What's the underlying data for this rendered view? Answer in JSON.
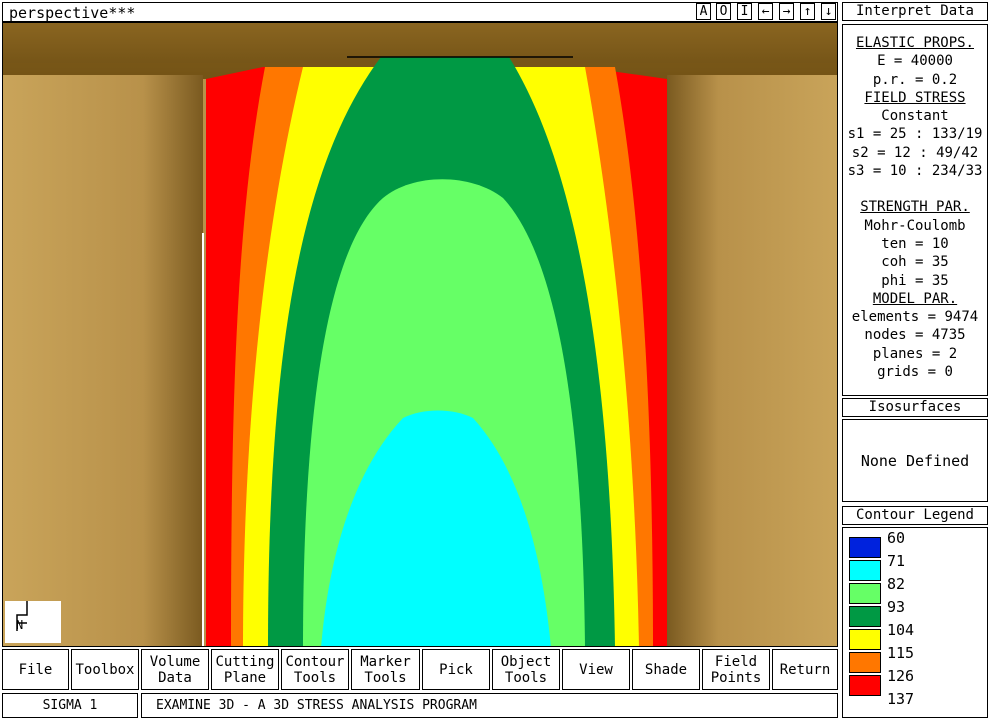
{
  "window": {
    "title": "perspective***",
    "nav_buttons": [
      "A",
      "O",
      "I",
      "←",
      "→",
      "↑",
      "↓"
    ]
  },
  "sidepanel": {
    "interpret_header": "Interpret Data",
    "elastic_header": "ELASTIC PROPS.",
    "e_value": "E = 40000",
    "pr_value": "p.r. = 0.2",
    "field_stress_header": "FIELD STRESS",
    "field_stress_type": "Constant",
    "s1": "s1 = 25 : 133/19",
    "s2": "s2 = 12 : 49/42",
    "s3": "s3 = 10 : 234/33",
    "strength_header": "STRENGTH PAR.",
    "strength_model": "Mohr-Coulomb",
    "ten": "ten = 10",
    "coh": "coh = 35",
    "phi": "phi = 35",
    "model_header": "MODEL PAR.",
    "elements": "elements = 9474",
    "nodes": "nodes = 4735",
    "planes": "planes = 2",
    "grids": "grids = 0",
    "isosurfaces_header": "Isosurfaces",
    "isosurfaces_value": "None Defined",
    "legend_header": "Contour Legend",
    "legend": [
      {
        "value": "60",
        "color": "#0022dd"
      },
      {
        "value": "71",
        "color": "#00ffff"
      },
      {
        "value": "82",
        "color": "#66ff66"
      },
      {
        "value": "93",
        "color": "#009944"
      },
      {
        "value": "104",
        "color": "#ffff00"
      },
      {
        "value": "115",
        "color": "#ff7700"
      },
      {
        "value": "126",
        "color": "#ff0000"
      },
      {
        "value": "137",
        "color": "#ffffff"
      }
    ]
  },
  "toolbar": {
    "file": "File",
    "toolbox": "Toolbox",
    "volume_data": "Volume\nData",
    "cutting_plane": "Cutting\nPlane",
    "contour_tools": "Contour\nTools",
    "marker_tools": "Marker\nTools",
    "pick": "Pick",
    "object_tools": "Object\nTools",
    "view": "View",
    "shade": "Shade",
    "field_points": "Field\nPoints",
    "return": "Return"
  },
  "status": {
    "quantity": "SIGMA 1",
    "program": "EXAMINE 3D - A 3D STRESS ANALYSIS PROGRAM"
  },
  "colors": {
    "rock": "#b8914a",
    "rock_dark": "#7a5a20",
    "contour_red": "#ff0000",
    "contour_orange": "#ff7700",
    "contour_yellow": "#ffff00",
    "contour_dark_green": "#009944",
    "contour_light_green": "#66ff66",
    "contour_cyan": "#00ffff"
  }
}
